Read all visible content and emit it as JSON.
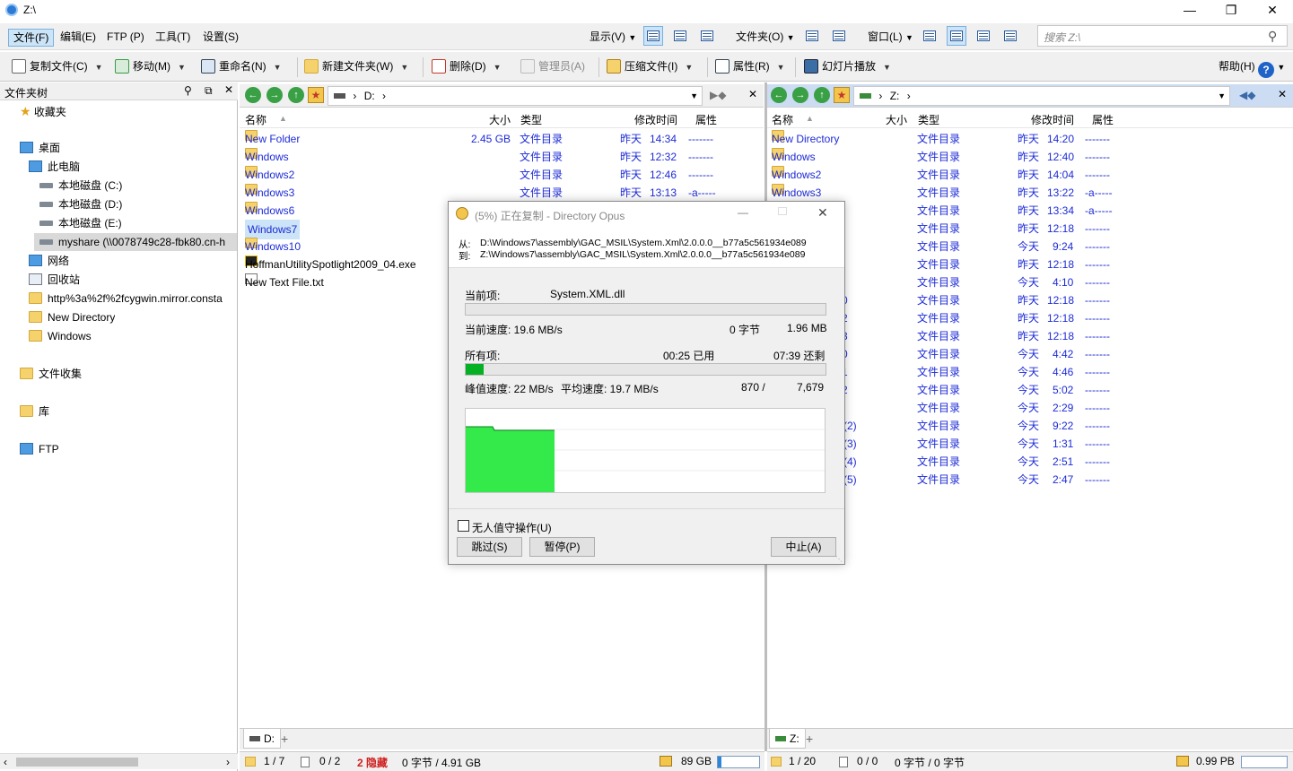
{
  "window": {
    "title": "Z:\\"
  },
  "menu": {
    "items": [
      "文件(F)",
      "编辑(E)",
      "FTP (P)",
      "工具(T)",
      "设置(S)"
    ],
    "right_items": [
      "显示(V)",
      "文件夹(O)",
      "窗口(L)"
    ],
    "search_placeholder": "搜索 Z:\\"
  },
  "toolbar": {
    "copy": "复制文件(C)",
    "move": "移动(M)",
    "rename": "重命名(N)",
    "newfolder": "新建文件夹(W)",
    "delete": "删除(D)",
    "admin": "管理员(A)",
    "zip": "压缩文件(I)",
    "props": "属性(R)",
    "slideshow": "幻灯片播放",
    "help": "帮助(H)"
  },
  "tree": {
    "header": "文件夹树",
    "items": [
      {
        "label": "收藏夹",
        "icon": "star-icon"
      },
      {
        "label": "桌面",
        "icon": "desktop-icon"
      },
      {
        "label": "此电脑",
        "icon": "pc-icon"
      },
      {
        "label": "本地磁盘 (C:)",
        "icon": "drive-icon"
      },
      {
        "label": "本地磁盘 (D:)",
        "icon": "drive-icon"
      },
      {
        "label": "本地磁盘 (E:)",
        "icon": "drive-icon"
      },
      {
        "label": "myshare (\\\\0078749c28-fbk80.cn-h",
        "icon": "network-drive-icon"
      },
      {
        "label": "网络",
        "icon": "network-icon"
      },
      {
        "label": "回收站",
        "icon": "recycle-icon"
      },
      {
        "label": "http%3a%2f%2fcygwin.mirror.consta",
        "icon": "folder-icon"
      },
      {
        "label": "New Directory",
        "icon": "folder-icon"
      },
      {
        "label": "Windows",
        "icon": "folder-icon"
      },
      {
        "label": "文件收集",
        "icon": "collection-icon"
      },
      {
        "label": "库",
        "icon": "library-icon"
      },
      {
        "label": "FTP",
        "icon": "ftp-icon"
      }
    ]
  },
  "left_pane": {
    "path": "D:",
    "columns": [
      "名称",
      "大小",
      "类型",
      "修改时间",
      "属性"
    ],
    "rows": [
      {
        "name": "New Folder",
        "size": "2.45 GB",
        "type": "文件目录",
        "day": "昨天",
        "time": "14:34",
        "attr": "-------"
      },
      {
        "name": "Windows",
        "size": "",
        "type": "文件目录",
        "day": "昨天",
        "time": "12:32",
        "attr": "-------"
      },
      {
        "name": "Windows2",
        "size": "",
        "type": "文件目录",
        "day": "昨天",
        "time": "12:46",
        "attr": "-------"
      },
      {
        "name": "Windows3",
        "size": "",
        "type": "文件目录",
        "day": "昨天",
        "time": "13:13",
        "attr": "-a-----"
      },
      {
        "name": "Windows6",
        "size": "",
        "type": "",
        "day": "",
        "time": "",
        "attr": ""
      },
      {
        "name": "Windows7",
        "size": "",
        "type": "",
        "day": "",
        "time": "",
        "attr": ""
      },
      {
        "name": "Windows10",
        "size": "",
        "type": "",
        "day": "",
        "time": "",
        "attr": ""
      }
    ],
    "files": [
      "HoffmanUtilitySpotlight2009_04.exe",
      "New Text File.txt"
    ],
    "tab": "D:",
    "status": {
      "count": "1 / 7",
      "files": "0 / 2",
      "hidden": "2 隐藏",
      "bytes": "0 字节 / 4.91 GB",
      "free": "89 GB"
    }
  },
  "right_pane": {
    "path": "Z:",
    "columns": [
      "名称",
      "大小",
      "类型",
      "修改时间",
      "属性"
    ],
    "rows": [
      {
        "name": "New Directory",
        "type": "文件目录",
        "day": "昨天",
        "time": "14:20",
        "attr": "-------"
      },
      {
        "name": "Windows",
        "type": "文件目录",
        "day": "昨天",
        "time": "12:40",
        "attr": "-------"
      },
      {
        "name": "Windows2",
        "type": "文件目录",
        "day": "昨天",
        "time": "14:04",
        "attr": "-------"
      },
      {
        "name": "Windows3",
        "type": "文件目录",
        "day": "昨天",
        "time": "13:22",
        "attr": "-a-----"
      },
      {
        "name": "",
        "type": "文件目录",
        "day": "昨天",
        "time": "13:34",
        "attr": "-a-----"
      },
      {
        "name": "",
        "type": "文件目录",
        "day": "昨天",
        "time": "12:18",
        "attr": "-------"
      },
      {
        "name": "",
        "type": "文件目录",
        "day": "今天",
        "time": "9:24",
        "attr": "-------"
      },
      {
        "name": "",
        "type": "文件目录",
        "day": "昨天",
        "time": "12:18",
        "attr": "-------"
      },
      {
        "name": "",
        "type": "文件目录",
        "day": "今天",
        "time": "4:10",
        "attr": "-------"
      },
      {
        "name": "0",
        "type": "文件目录",
        "day": "昨天",
        "time": "12:18",
        "attr": "-------"
      },
      {
        "name": "2",
        "type": "文件目录",
        "day": "昨天",
        "time": "12:18",
        "attr": "-------"
      },
      {
        "name": "3",
        "type": "文件目录",
        "day": "昨天",
        "time": "12:18",
        "attr": "-------"
      },
      {
        "name": "0",
        "type": "文件目录",
        "day": "今天",
        "time": "4:42",
        "attr": "-------"
      },
      {
        "name": "1",
        "type": "文件目录",
        "day": "今天",
        "time": "4:46",
        "attr": "-------"
      },
      {
        "name": "2",
        "type": "文件目录",
        "day": "今天",
        "time": "5:02",
        "attr": "-------"
      },
      {
        "name": "",
        "type": "文件目录",
        "day": "今天",
        "time": "2:29",
        "attr": "-------"
      },
      {
        "name": "(2)",
        "type": "文件目录",
        "day": "今天",
        "time": "9:22",
        "attr": "-------"
      },
      {
        "name": "(3)",
        "type": "文件目录",
        "day": "今天",
        "time": "1:31",
        "attr": "-------"
      },
      {
        "name": "(4)",
        "type": "文件目录",
        "day": "今天",
        "time": "2:51",
        "attr": "-------"
      },
      {
        "name": "(5)",
        "type": "文件目录",
        "day": "今天",
        "time": "2:47",
        "attr": "-------"
      }
    ],
    "tab": "Z:",
    "status": {
      "count": "1 / 20",
      "files": "0 / 0",
      "bytes": "0 字节 / 0 字节",
      "free": "0.99 PB"
    }
  },
  "dialog": {
    "title": "(5%) 正在复制 - Directory Opus",
    "from_label": "从:",
    "from_path": "D:\\Windows7\\assembly\\GAC_MSIL\\System.Xml\\2.0.0.0__b77a5c561934e089",
    "to_label": "到:",
    "to_path": "Z:\\Windows7\\assembly\\GAC_MSIL\\System.Xml\\2.0.0.0__b77a5c561934e089",
    "current_label": "当前项:",
    "current_item": "System.XML.dll",
    "current_speed": "当前速度: 19.6 MB/s",
    "current_bytes": "0 字节",
    "current_size": "1.96 MB",
    "current_progress": 0.0,
    "all_label": "所有项:",
    "elapsed": "00:25 已用",
    "remaining": "07:39 还剩",
    "all_progress": 0.05,
    "peak": "峰值速度: 22 MB/s",
    "avg": "平均速度: 19.7 MB/s",
    "done_count": "870 /",
    "total_count": "7,679",
    "unattended": "无人值守操作(U)",
    "skip": "跳过(S)",
    "pause": "暂停(P)",
    "abort": "中止(A)"
  }
}
